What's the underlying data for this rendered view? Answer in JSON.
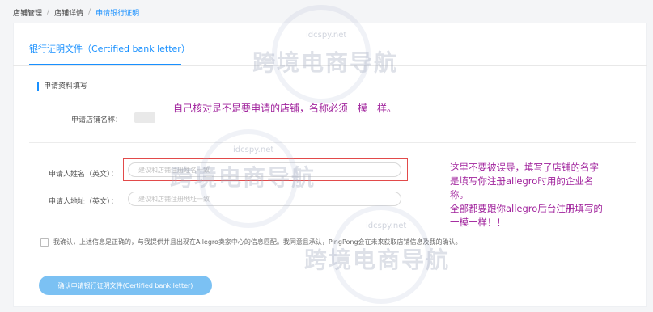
{
  "breadcrumb": {
    "items": [
      "店铺管理",
      "店铺详情",
      "申请银行证明"
    ]
  },
  "tab": {
    "label": "银行证明文件（Certified bank letter）"
  },
  "section": {
    "title": "申请资料填写"
  },
  "form": {
    "store_name_label": "申请店铺名称：",
    "applicant_name_label": "申请人姓名（英文）：",
    "applicant_name_placeholder": "建议和店铺注册姓名一致",
    "applicant_address_label": "申请人地址（英文）：",
    "applicant_address_placeholder": "建议和店铺注册地址一致"
  },
  "annotations": {
    "note1": "自己核对是不是要申请的店铺，名称必须一模一样。",
    "note2_line1": "这里不要被误导，填写了店铺的名字",
    "note2_line2": "是填写你注册allegro时用的企业名",
    "note2_line3": "称。",
    "note2_line4": "全部都要跟你allegro后台注册填写的",
    "note2_line5": "一模一样！！"
  },
  "confirm": {
    "text": "我确认，上述信息是正确的，与我提供并且出现在Allegro卖家中心的信息匹配。我同意且承认，PingPong会在未来获取店铺信息及我的确认。"
  },
  "submit": {
    "label": "确认申请银行证明文件(Certified bank letter)"
  },
  "watermark": {
    "url": "idcspy.net",
    "text": "跨境电商导航"
  },
  "colors": {
    "accent": "#1890ff",
    "annotation": "#a0229c",
    "highlight": "#e24a4a",
    "button": "#7bc1f3"
  }
}
